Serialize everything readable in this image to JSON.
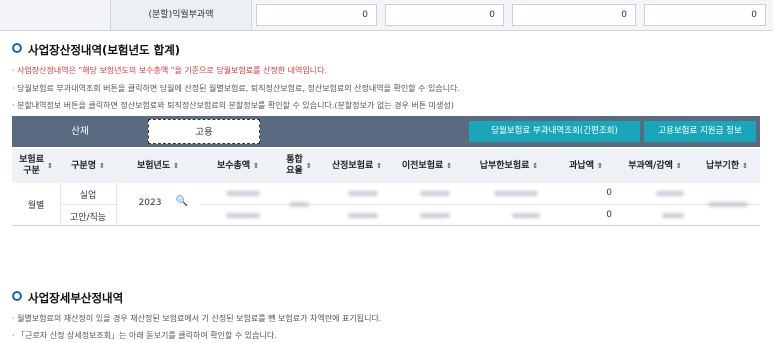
{
  "top_row": {
    "label": "(분할)익월부과액",
    "values": [
      "0",
      "0",
      "0",
      "0"
    ]
  },
  "section1": {
    "title": "사업장산정내역(보험년도 합계)",
    "notes": [
      "· 사업장산정내역은 \"해당 보험년도의 보수총액 \"을 기준으로 당월보험료를 산정한 내역입니다.",
      "· 당월보험료 부과내역조회 버튼을 클릭하면 당월에 산정된 월별보험료, 퇴직정산보험료, 정산보험료의 산정내역을 확인할 수 있습니다.",
      "· 분할내역정보 버튼을 클릭하면 정산보험료와 퇴직정산보험료의  분할정보를 확인할 수 있습니다.(분할정보가 없는 경우 버튼 미생성)"
    ]
  },
  "tabs": {
    "sanjae": "산재",
    "goyong": "고용"
  },
  "buttons": {
    "monthly_inquiry": "당월보험료 부과내역조회(간편조회)",
    "support_info": "고용보험료 지원금 정보"
  },
  "table": {
    "headers": [
      "보험료\n구분",
      "구분명",
      "보험년도",
      "보수총액",
      "통합\n요율",
      "산정보험료",
      "이전보험료",
      "납부한보험료",
      "과납액",
      "부과액/감액",
      "납부기한"
    ],
    "row": {
      "type": "월별",
      "sub_types": [
        "실업",
        "고안/직능"
      ],
      "year": "2023",
      "overpaid": [
        "0",
        "0"
      ]
    }
  },
  "section2": {
    "title": "사업장세부산정내역",
    "notes": [
      "· 월별보험료의 재산정이 있을 경우 재산정된 보험료에서 기 산정된 보험료를 뺀 보험료가 차액란에 표기됩니다.",
      "· 「근로자 산정 상세정보조회」는 아래 돋보기를 클릭하여 확인할 수 있습니다."
    ]
  },
  "colors": {
    "tab_bar": "#5a6b7f",
    "button": "#19a6b8",
    "red_note": "#e03a3a",
    "bullet": "#1a63ad"
  }
}
